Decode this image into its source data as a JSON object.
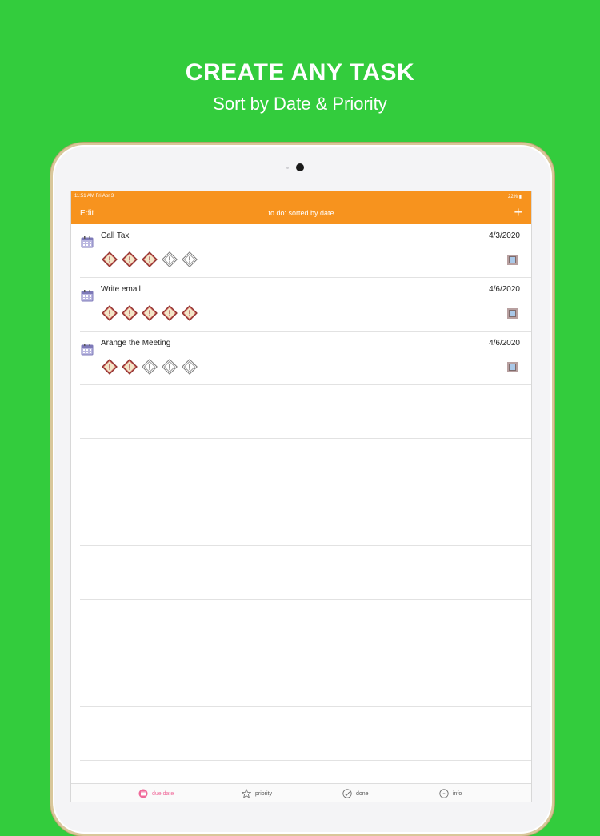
{
  "promo": {
    "title": "CREATE ANY TASK",
    "subtitle": "Sort by Date & Priority"
  },
  "status_bar": {
    "time": "11:51 AM  Fri Apr 3",
    "battery": "22% ▮"
  },
  "nav": {
    "edit_label": "Edit",
    "title": "to do: sorted by date",
    "add_label": "+"
  },
  "tasks": [
    {
      "title": "Call Taxi",
      "date": "4/3/2020",
      "priority": 3,
      "priority_max": 5
    },
    {
      "title": "Write email",
      "date": "4/6/2020",
      "priority": 5,
      "priority_max": 5
    },
    {
      "title": "Arange the Meeting",
      "date": "4/6/2020",
      "priority": 2,
      "priority_max": 5
    }
  ],
  "tabs": [
    {
      "label": "due date",
      "icon": "calendar-icon",
      "active": true
    },
    {
      "label": "priority",
      "icon": "star-icon",
      "active": false
    },
    {
      "label": "done",
      "icon": "check-circle-icon",
      "active": false
    },
    {
      "label": "info",
      "icon": "more-circle-icon",
      "active": false
    }
  ],
  "colors": {
    "background": "#33cc3d",
    "accent": "#f7931e",
    "priority_active": "#c0504d",
    "active_tab": "#f06a9a"
  }
}
